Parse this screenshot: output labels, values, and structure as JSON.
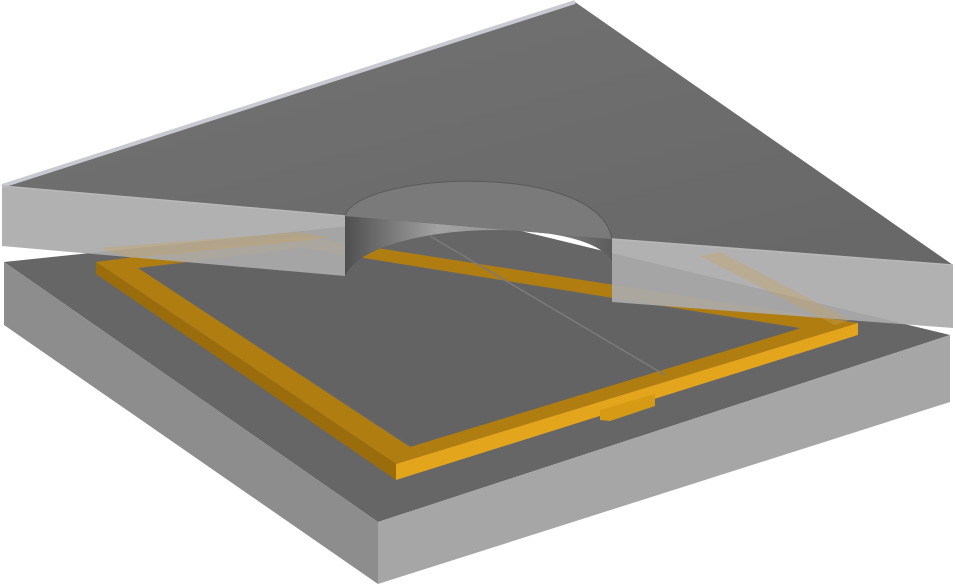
{
  "scene": {
    "description_visible_text": "",
    "colors": {
      "background": "#ffffff",
      "substrate_top": "#666666",
      "substrate_front": "#a5a5a5",
      "substrate_left": "#8a8a8a",
      "gold_top": "#b8860b",
      "gold_side": "#e0a41a",
      "gold_dark": "#7a5510",
      "lid_top": "#6b6b6b",
      "lid_front": "#a9a9a9",
      "lid_edge_highlight": "#c8c8cf",
      "cavity_wall_light": "#9a9a9a",
      "cavity_wall_dark": "#5e5e5e"
    }
  }
}
